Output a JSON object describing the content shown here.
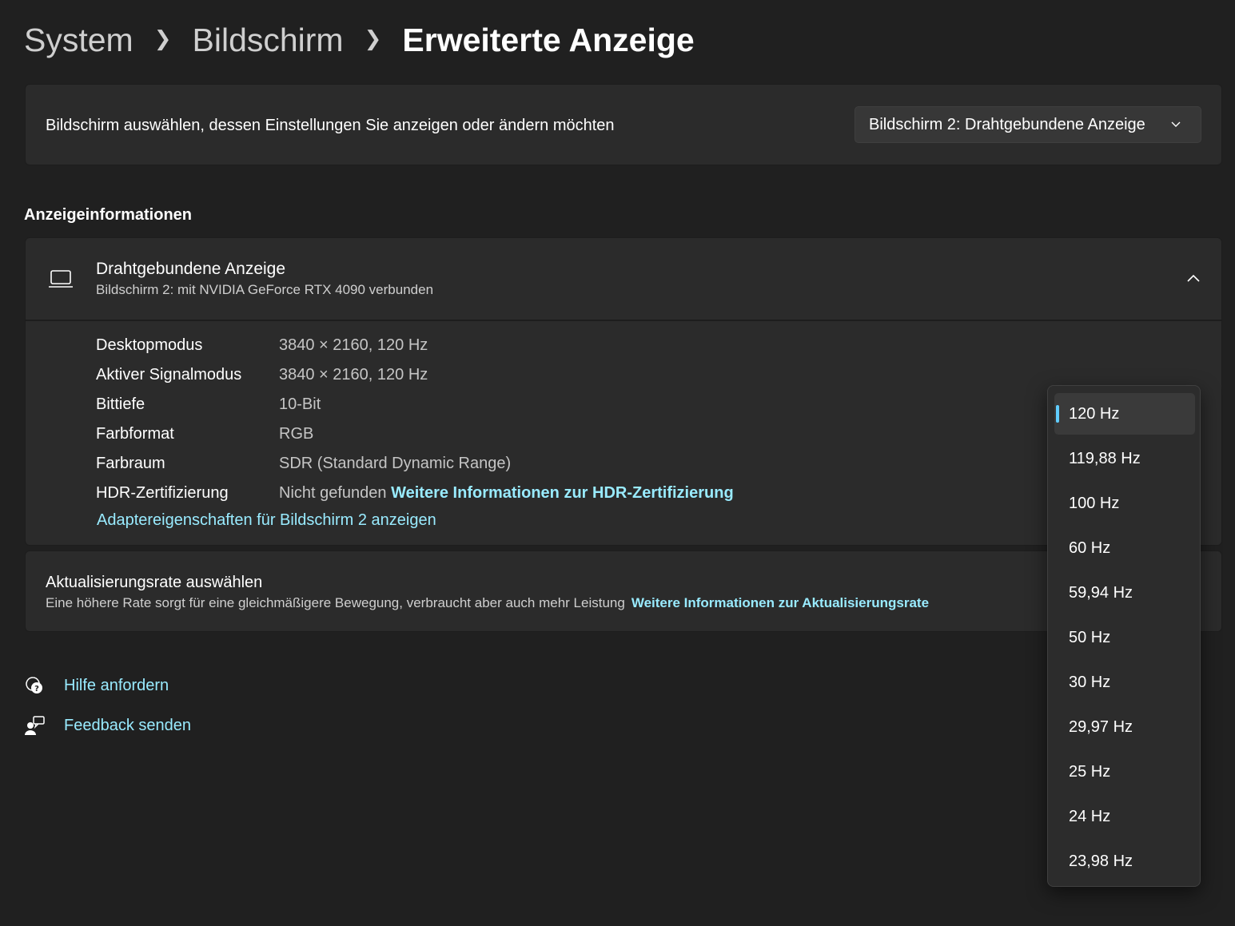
{
  "breadcrumb": {
    "items": [
      "System",
      "Bildschirm",
      "Erweiterte Anzeige"
    ]
  },
  "display_select": {
    "label": "Bildschirm auswählen, dessen Einstellungen Sie anzeigen oder ändern möchten",
    "value": "Bildschirm 2: Drahtgebundene Anzeige"
  },
  "section_title": "Anzeigeinformationen",
  "display_info": {
    "title": "Drahtgebundene Anzeige",
    "subtitle": "Bildschirm 2: mit NVIDIA GeForce RTX 4090 verbunden",
    "rows": [
      {
        "key": "Desktopmodus",
        "value": "3840 × 2160, 120 Hz"
      },
      {
        "key": "Aktiver Signalmodus",
        "value": "3840 × 2160, 120 Hz"
      },
      {
        "key": "Bittiefe",
        "value": "10-Bit"
      },
      {
        "key": "Farbformat",
        "value": "RGB"
      },
      {
        "key": "Farbraum",
        "value": "SDR (Standard Dynamic Range)"
      },
      {
        "key": "HDR-Zertifizierung",
        "value": "Nicht gefunden",
        "link": "Weitere Informationen zur HDR-Zertifizierung"
      }
    ],
    "adapter_link": "Adaptereigenschaften für Bildschirm 2 anzeigen"
  },
  "refresh_rate": {
    "title": "Aktualisierungsrate auswählen",
    "description": "Eine höhere Rate sorgt für eine gleichmäßigere Bewegung, verbraucht aber auch mehr Leistung",
    "link": "Weitere Informationen zur Aktualisierungsrate",
    "options": [
      "120 Hz",
      "119,88 Hz",
      "100 Hz",
      "60 Hz",
      "59,94 Hz",
      "50 Hz",
      "30 Hz",
      "29,97 Hz",
      "25 Hz",
      "24 Hz",
      "23,98 Hz"
    ],
    "selected": "120 Hz"
  },
  "help_links": {
    "help": "Hilfe anfordern",
    "feedback": "Feedback senden"
  },
  "colors": {
    "background": "#202020",
    "card": "#2b2b2b",
    "accent": "#60cdff",
    "link": "#99ebff"
  }
}
